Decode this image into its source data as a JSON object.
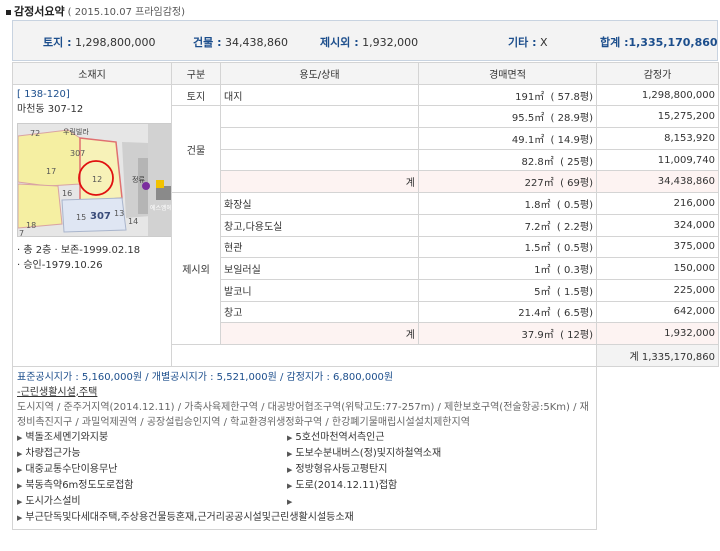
{
  "header": {
    "title": "감정서요약",
    "subtitle": "( 2015.10.07  프라임감정)"
  },
  "summary": {
    "land": {
      "label": "토지 :",
      "value": "1,298,800,000"
    },
    "building": {
      "label": "건물 :",
      "value": "34,438,860"
    },
    "excluded": {
      "label": "제시외 :",
      "value": "1,932,000"
    },
    "other": {
      "label": "기타 :",
      "value": "X"
    },
    "total": {
      "label": "합계 :",
      "value": "1,335,170,860"
    }
  },
  "columns": [
    "소재지",
    "구분",
    "용도/상태",
    "경매면적",
    "감정가"
  ],
  "location": {
    "code": "[ 138-120]",
    "address": "마천동 307-12",
    "details": [
      "· 총 2층  · 보존-1999.02.18",
      "· 승인-1979.10.26"
    ]
  },
  "map": {
    "labels": [
      "72",
      "우림빌라",
      "307",
      "17",
      "16",
      "12",
      "15",
      "307",
      "13",
      "14",
      "18",
      "7",
      "정류",
      "에스엠에이치"
    ]
  },
  "land_rows": [
    {
      "category": "토지",
      "use": "대지",
      "area": "191㎡",
      "pyeong": "( 57.8평)",
      "price": "1,298,800,000"
    }
  ],
  "building": {
    "category": "건물",
    "rows": [
      {
        "use": "",
        "area": "95.5㎡",
        "pyeong": "( 28.9평)",
        "price": "15,275,200"
      },
      {
        "use": "",
        "area": "49.1㎡",
        "pyeong": "( 14.9평)",
        "price": "8,153,920"
      },
      {
        "use": "",
        "area": "82.8㎡",
        "pyeong": "( 25평)",
        "price": "11,009,740"
      }
    ],
    "subtotal": {
      "label": "계",
      "area": "227㎡",
      "pyeong": "( 69평)",
      "price": "34,438,860"
    }
  },
  "excluded": {
    "category": "제시외",
    "rows": [
      {
        "use": "화장실",
        "area": "1.8㎡",
        "pyeong": "( 0.5평)",
        "price": "216,000"
      },
      {
        "use": "창고,다용도실",
        "area": "7.2㎡",
        "pyeong": "( 2.2평)",
        "price": "324,000"
      },
      {
        "use": "현관",
        "area": "1.5㎡",
        "pyeong": "( 0.5평)",
        "price": "375,000"
      },
      {
        "use": "보일러실",
        "area": "1㎡",
        "pyeong": "( 0.3평)",
        "price": "150,000"
      },
      {
        "use": "발코니",
        "area": "5㎡",
        "pyeong": "( 1.5평)",
        "price": "225,000"
      },
      {
        "use": "창고",
        "area": "21.4㎡",
        "pyeong": "( 6.5평)",
        "price": "642,000"
      }
    ],
    "subtotal": {
      "label": "계",
      "area": "37.9㎡",
      "pyeong": "( 12평)",
      "price": "1,932,000"
    }
  },
  "grand_total": "계  1,335,170,860",
  "notes": {
    "prices": "표준공시지가 : 5,160,000원 / 개별공시지가 : 5,521,000원 / 감정지가 : 6,800,000원",
    "usage": "-근린생활시설,주택",
    "zoning": "도시지역 / 준주거지역(2014.12.11) / 가축사육제한구역 / 대공방어협조구역(위탁고도:77-257m) / 제한보호구역(전술항공:5Km) / 재정비촉진지구 / 과밀억제권역 / 공장설립승인지역 / 학교환경위생정화구역 / 한강폐기물매립시설설치제한지역",
    "bullets": [
      "벽돌조세멘기와지붕",
      "5호선마천역서측인근",
      "차량접근가능",
      "도보수분내버스(정)및지하철역소재",
      "대중교통수단이용무난",
      "정방형유사등고평탄지",
      "북동측약6m정도도로접함",
      "도로(2014.12.11)접함",
      "도시가스설비",
      "부근단독및다세대주택,주상용건물등혼재,근거리공공시설및근린생활시설등소재"
    ]
  }
}
